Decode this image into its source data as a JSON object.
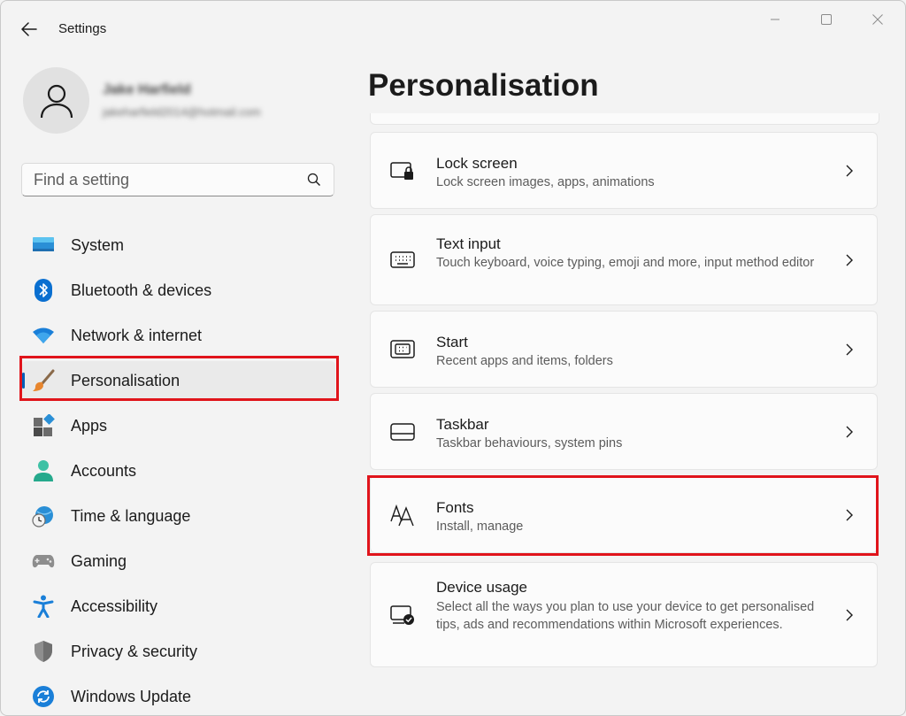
{
  "window": {
    "title": "Settings",
    "minimize_icon": "minimize-icon",
    "maximize_icon": "maximize-icon",
    "close_icon": "close-icon"
  },
  "profile": {
    "name": "Jake Harfield",
    "email": "jakeharfield2014@hotmail.com"
  },
  "search": {
    "placeholder": "Find a setting"
  },
  "sidebar": {
    "items": [
      {
        "label": "System",
        "icon": "system-icon"
      },
      {
        "label": "Bluetooth & devices",
        "icon": "bluetooth-icon"
      },
      {
        "label": "Network & internet",
        "icon": "wifi-icon"
      },
      {
        "label": "Personalisation",
        "icon": "paintbrush-icon",
        "selected": true
      },
      {
        "label": "Apps",
        "icon": "apps-icon"
      },
      {
        "label": "Accounts",
        "icon": "accounts-icon"
      },
      {
        "label": "Time & language",
        "icon": "clock-globe-icon"
      },
      {
        "label": "Gaming",
        "icon": "gamepad-icon"
      },
      {
        "label": "Accessibility",
        "icon": "accessibility-icon"
      },
      {
        "label": "Privacy & security",
        "icon": "shield-icon"
      },
      {
        "label": "Windows Update",
        "icon": "update-icon"
      }
    ]
  },
  "main": {
    "title": "Personalisation",
    "cards": [
      {
        "title": "Lock screen",
        "description": "Lock screen images, apps, animations",
        "icon": "lock-screen-icon"
      },
      {
        "title": "Text input",
        "description": "Touch keyboard, voice typing, emoji and more, input method editor",
        "icon": "keyboard-icon"
      },
      {
        "title": "Start",
        "description": "Recent apps and items, folders",
        "icon": "start-icon"
      },
      {
        "title": "Taskbar",
        "description": "Taskbar behaviours, system pins",
        "icon": "taskbar-icon"
      },
      {
        "title": "Fonts",
        "description": "Install, manage",
        "icon": "fonts-icon"
      },
      {
        "title": "Device usage",
        "description": "Select all the ways you plan to use your device to get personalised tips, ads and recommendations within Microsoft experiences.",
        "icon": "device-usage-icon"
      }
    ]
  },
  "colors": {
    "accent": "#005fb8",
    "highlight_box": "#e0141b",
    "background": "#f3f3f3",
    "card": "#fbfbfb"
  }
}
